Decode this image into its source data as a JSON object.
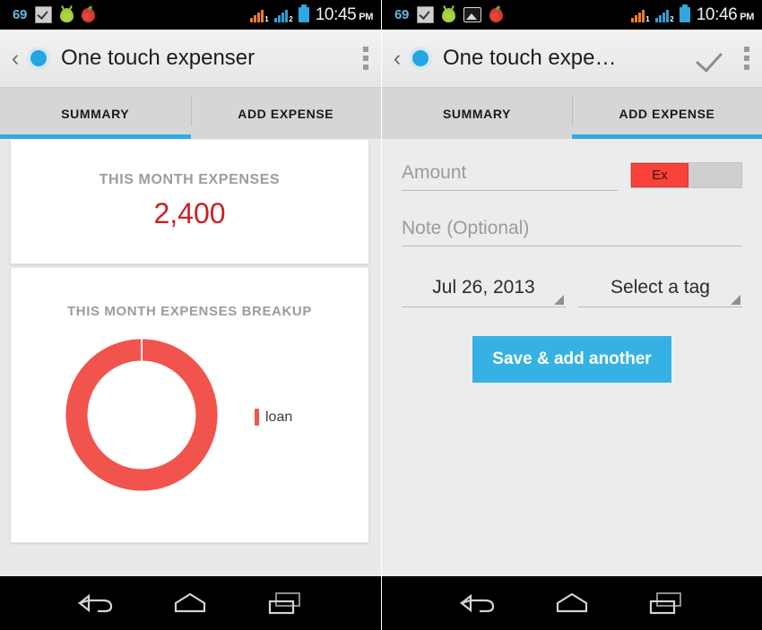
{
  "brand": {
    "accent_blue": "#2fabe1",
    "accent_red": "#f0544d",
    "amount_red": "#cb2027",
    "toggle_red": "#f9423a"
  },
  "left_phone": {
    "status_bar": {
      "notification_count": "69",
      "icons": [
        "check-icon",
        "android-icon",
        "apple-icon"
      ],
      "signal_1_label": "1",
      "signal_2_label": "2",
      "time": "10:45",
      "ampm": "PM"
    },
    "action_bar": {
      "back_glyph": "‹",
      "app_icon": "app-circle-icon",
      "title": "One touch expenser",
      "overflow": "overflow-menu-icon"
    },
    "tabs": [
      {
        "label": "SUMMARY",
        "active": true
      },
      {
        "label": "ADD EXPENSE",
        "active": false
      }
    ],
    "summary": {
      "total_card": {
        "label": "THIS MONTH EXPENSES",
        "amount": "2,400"
      },
      "breakup_card": {
        "label": "THIS MONTH EXPENSES BREAKUP",
        "legend": [
          {
            "name": "loan",
            "color": "#f0544d"
          }
        ]
      }
    },
    "nav_bar": {
      "back": "back-nav-icon",
      "home": "home-nav-icon",
      "recents": "recents-nav-icon"
    }
  },
  "right_phone": {
    "status_bar": {
      "notification_count": "69",
      "icons": [
        "check-icon",
        "android-icon",
        "gallery-icon",
        "apple-icon"
      ],
      "signal_1_label": "1",
      "signal_2_label": "2",
      "time": "10:46",
      "ampm": "PM"
    },
    "action_bar": {
      "back_glyph": "‹",
      "app_icon": "app-circle-icon",
      "title": "One touch expe…",
      "done": "check-done-icon",
      "overflow": "overflow-menu-icon"
    },
    "tabs": [
      {
        "label": "SUMMARY",
        "active": false
      },
      {
        "label": "ADD EXPENSE",
        "active": true
      }
    ],
    "form": {
      "amount_placeholder": "Amount",
      "amount_value": "",
      "type_toggle_label": "Ex",
      "note_placeholder": "Note (Optional)",
      "note_value": "",
      "date_value": "Jul 26, 2013",
      "tag_value": "Select a tag",
      "save_label": "Save & add another"
    },
    "nav_bar": {
      "back": "back-nav-icon",
      "home": "home-nav-icon",
      "recents": "recents-nav-icon"
    }
  },
  "chart_data": {
    "type": "pie",
    "title": "THIS MONTH EXPENSES BREAKUP",
    "variant": "donut",
    "categories": [
      "loan"
    ],
    "values": [
      2400
    ],
    "percentages": [
      100
    ],
    "colors": [
      "#f0544d"
    ],
    "total": 2400,
    "legend_position": "right",
    "inner_radius_ratio": 0.72,
    "grid": false
  }
}
